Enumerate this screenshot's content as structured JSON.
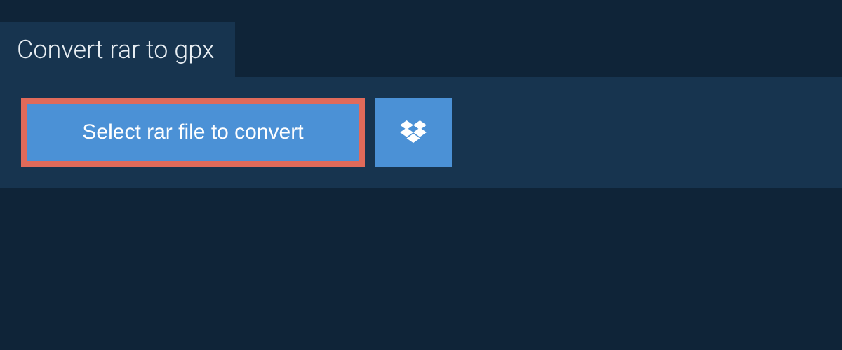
{
  "tab": {
    "title": "Convert rar to gpx"
  },
  "actions": {
    "select_file_label": "Select rar file to convert"
  }
}
